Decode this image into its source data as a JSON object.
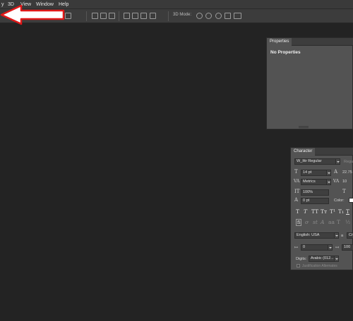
{
  "menu": {
    "items": [
      "y",
      "3D",
      "View",
      "Window",
      "Help"
    ]
  },
  "toolbar": {
    "mode_label": "3D Mode:"
  },
  "properties_panel": {
    "tab_label": "Properties",
    "content": "No Properties"
  },
  "character_panel": {
    "tab_label": "Character",
    "font_family": "W_Ittr Regular",
    "font_style": "Regu",
    "font_size": "14 pt",
    "leading": "22.75",
    "kerning": "Metrics",
    "tracking": "10",
    "vertical_scale": "100%",
    "baseline_shift": "0 pt",
    "color_label": "Color:",
    "color_value": "#ffffff",
    "language": "English: USA",
    "aa_prefix": "a",
    "aa_value": "Cr",
    "indent_left": "0",
    "indent_right": "100",
    "digits_label": "Digits:",
    "digits_value": "Arabic (012...",
    "justification_label": "Justification Alternates"
  }
}
